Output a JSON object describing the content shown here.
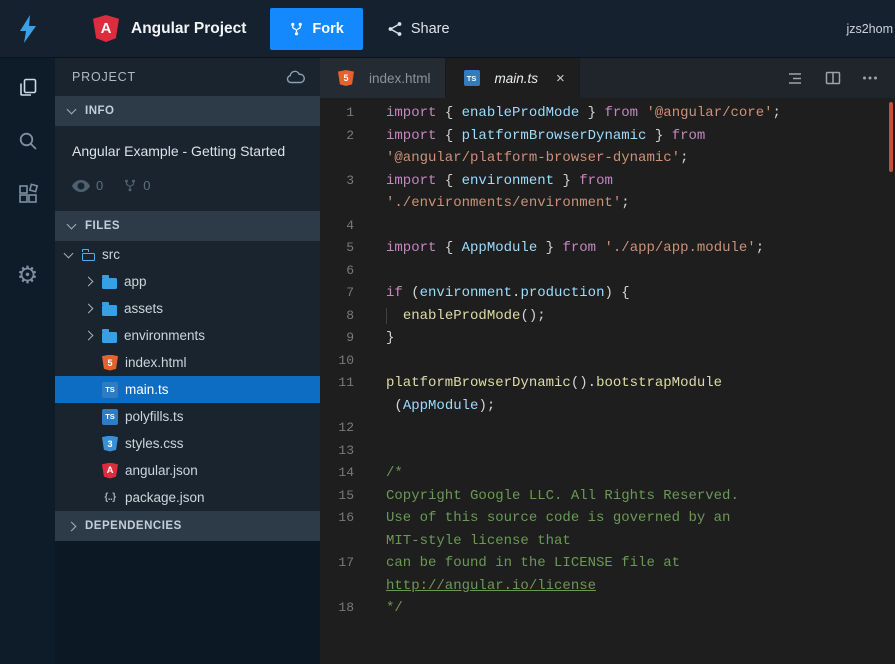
{
  "topbar": {
    "title": "Angular Project",
    "fork_label": "Fork",
    "share_label": "Share",
    "user": "jzs2hom"
  },
  "glyphs": {
    "gear": "⚙"
  },
  "sidebar": {
    "header": "PROJECT",
    "info": {
      "label": "INFO",
      "project_title": "Angular Example - Getting Started",
      "views_count": "0",
      "forks_count": "0"
    },
    "files": {
      "label": "FILES",
      "items": [
        {
          "name": "src",
          "icon": "folder-open",
          "depth": 0,
          "expanded": true,
          "selected": false
        },
        {
          "name": "app",
          "icon": "folder",
          "depth": 1,
          "expanded": false,
          "selected": false
        },
        {
          "name": "assets",
          "icon": "folder",
          "depth": 1,
          "expanded": false,
          "selected": false
        },
        {
          "name": "environments",
          "icon": "folder",
          "depth": 1,
          "expanded": false,
          "selected": false
        },
        {
          "name": "index.html",
          "icon": "html",
          "depth": 1,
          "selected": false
        },
        {
          "name": "main.ts",
          "icon": "ts",
          "depth": 1,
          "selected": true
        },
        {
          "name": "polyfills.ts",
          "icon": "ts",
          "depth": 1,
          "selected": false
        },
        {
          "name": "styles.css",
          "icon": "css",
          "depth": 1,
          "selected": false
        },
        {
          "name": "angular.json",
          "icon": "angular",
          "depth": 1,
          "selected": false
        },
        {
          "name": "package.json",
          "icon": "json",
          "depth": 1,
          "selected": false
        }
      ]
    },
    "dependencies": {
      "label": "DEPENDENCIES"
    }
  },
  "editor": {
    "tabs": [
      {
        "label": "index.html",
        "icon": "html"
      },
      {
        "label": "main.ts",
        "icon": "ts",
        "close": "×"
      }
    ],
    "code": {
      "lines": [
        {
          "num": "1",
          "tokens": [
            [
              "kw",
              "import "
            ],
            [
              "pun",
              "{ "
            ],
            [
              "id",
              "enableProdMode"
            ],
            [
              "pun",
              " } "
            ],
            [
              "kw",
              "from "
            ],
            [
              "str",
              "'@angular/core'"
            ],
            [
              "pun",
              ";"
            ]
          ]
        },
        {
          "num": "2",
          "tokens": [
            [
              "kw",
              "import "
            ],
            [
              "pun",
              "{ "
            ],
            [
              "id",
              "platformBrowserDynamic"
            ],
            [
              "pun",
              " } "
            ],
            [
              "kw",
              "from"
            ]
          ]
        },
        {
          "num": "",
          "tokens": [
            [
              "str",
              "'@angular/platform-browser-dynamic'"
            ],
            [
              "pun",
              ";"
            ]
          ]
        },
        {
          "num": "3",
          "tokens": [
            [
              "kw",
              "import "
            ],
            [
              "pun",
              "{ "
            ],
            [
              "id",
              "environment"
            ],
            [
              "pun",
              " } "
            ],
            [
              "kw",
              "from"
            ]
          ]
        },
        {
          "num": "",
          "tokens": [
            [
              "str",
              "'./environments/environment'"
            ],
            [
              "pun",
              ";"
            ]
          ]
        },
        {
          "num": "4",
          "tokens": []
        },
        {
          "num": "5",
          "tokens": [
            [
              "kw",
              "import "
            ],
            [
              "pun",
              "{ "
            ],
            [
              "id",
              "AppModule"
            ],
            [
              "pun",
              " } "
            ],
            [
              "kw",
              "from "
            ],
            [
              "str",
              "'./app/app.module'"
            ],
            [
              "pun",
              ";"
            ]
          ]
        },
        {
          "num": "6",
          "tokens": []
        },
        {
          "num": "7",
          "tokens": [
            [
              "kw",
              "if "
            ],
            [
              "pun",
              "("
            ],
            [
              "id",
              "environment"
            ],
            [
              "pun",
              "."
            ],
            [
              "id",
              "production"
            ],
            [
              "pun",
              ") {"
            ]
          ]
        },
        {
          "num": "8",
          "tokens": [
            [
              "guide",
              "  "
            ],
            [
              "fn",
              "enableProdMode"
            ],
            [
              "pun",
              "();"
            ]
          ]
        },
        {
          "num": "9",
          "tokens": [
            [
              "pun",
              "}"
            ]
          ]
        },
        {
          "num": "10",
          "tokens": []
        },
        {
          "num": "11",
          "tokens": [
            [
              "fn",
              "platformBrowserDynamic"
            ],
            [
              "pun",
              "()."
            ],
            [
              "fn",
              "bootstrapModule"
            ]
          ]
        },
        {
          "num": "",
          "tokens": [
            [
              "pun",
              " ("
            ],
            [
              "id",
              "AppModule"
            ],
            [
              "pun",
              ");"
            ]
          ]
        },
        {
          "num": "12",
          "tokens": []
        },
        {
          "num": "13",
          "tokens": []
        },
        {
          "num": "14",
          "tokens": [
            [
              "cmt",
              "/*"
            ]
          ]
        },
        {
          "num": "15",
          "tokens": [
            [
              "cmt",
              "Copyright Google LLC. All Rights Reserved."
            ]
          ]
        },
        {
          "num": "16",
          "tokens": [
            [
              "cmt",
              "Use of this source code is governed by an"
            ]
          ]
        },
        {
          "num": "",
          "tokens": [
            [
              "cmt",
              "MIT-style license that"
            ]
          ]
        },
        {
          "num": "17",
          "tokens": [
            [
              "cmt",
              "can be found in the LICENSE file at"
            ]
          ]
        },
        {
          "num": "",
          "tokens": [
            [
              "lnk",
              "http://angular.io/license"
            ]
          ]
        },
        {
          "num": "18",
          "tokens": [
            [
              "cmt",
              "*/"
            ]
          ]
        }
      ]
    }
  },
  "colors": {
    "accent": "#1389fd",
    "selected_file_bg": "#0d6dc2",
    "editor_bg": "#1e1e1e",
    "scroll_marker": "#c35039"
  }
}
